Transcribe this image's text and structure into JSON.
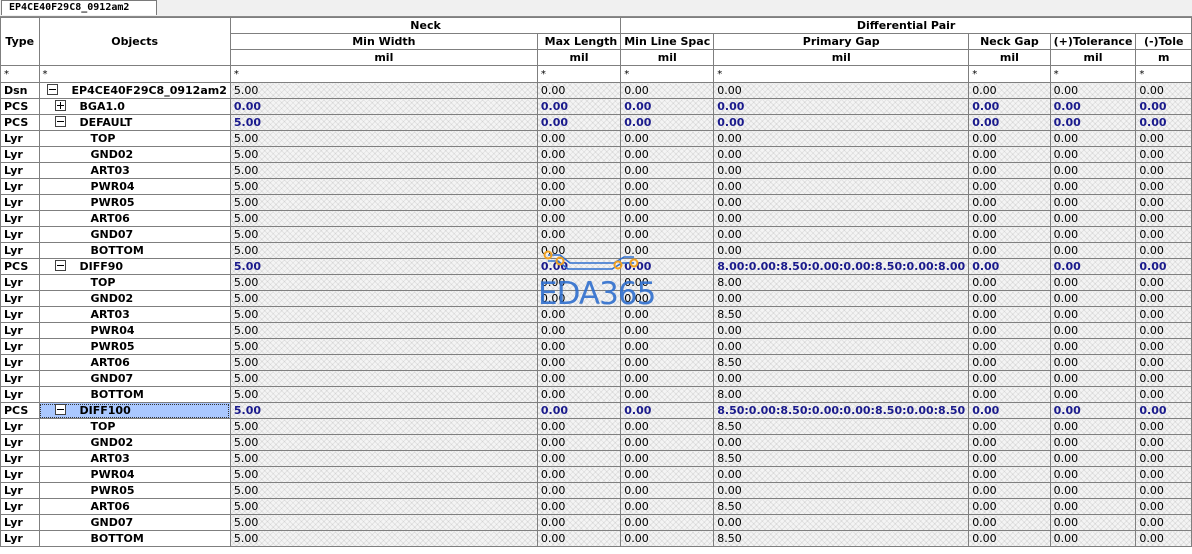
{
  "tab": {
    "title": "EP4CE40F29C8_0912am2"
  },
  "header": {
    "type": "Type",
    "objects": "Objects",
    "groups": {
      "neck": "Neck",
      "diff": "Differential Pair"
    },
    "columns": [
      "Min Width",
      "Max Length",
      "Min Line Spac",
      "Primary Gap",
      "Neck Gap",
      "(+)Tolerance",
      "(-)Tole"
    ],
    "units": [
      "mil",
      "mil",
      "mil",
      "mil",
      "mil",
      "mil",
      "m"
    ]
  },
  "filter": {
    "star": "*"
  },
  "rows": [
    {
      "type": "Dsn",
      "obj": "EP4CE40F29C8_0912am2",
      "vals": [
        "5.00",
        "0.00",
        "0.00",
        "0.00",
        "0.00",
        "0.00",
        "0.00"
      ]
    },
    {
      "type": "PCS",
      "obj": "BGA1.0",
      "vals": [
        "0.00",
        "0.00",
        "0.00",
        "0.00",
        "0.00",
        "0.00",
        "0.00"
      ]
    },
    {
      "type": "PCS",
      "obj": "DEFAULT",
      "vals": [
        "5.00",
        "0.00",
        "0.00",
        "0.00",
        "0.00",
        "0.00",
        "0.00"
      ]
    },
    {
      "type": "Lyr",
      "obj": "TOP",
      "vals": [
        "5.00",
        "0.00",
        "0.00",
        "0.00",
        "0.00",
        "0.00",
        "0.00"
      ]
    },
    {
      "type": "Lyr",
      "obj": "GND02",
      "vals": [
        "5.00",
        "0.00",
        "0.00",
        "0.00",
        "0.00",
        "0.00",
        "0.00"
      ]
    },
    {
      "type": "Lyr",
      "obj": "ART03",
      "vals": [
        "5.00",
        "0.00",
        "0.00",
        "0.00",
        "0.00",
        "0.00",
        "0.00"
      ]
    },
    {
      "type": "Lyr",
      "obj": "PWR04",
      "vals": [
        "5.00",
        "0.00",
        "0.00",
        "0.00",
        "0.00",
        "0.00",
        "0.00"
      ]
    },
    {
      "type": "Lyr",
      "obj": "PWR05",
      "vals": [
        "5.00",
        "0.00",
        "0.00",
        "0.00",
        "0.00",
        "0.00",
        "0.00"
      ]
    },
    {
      "type": "Lyr",
      "obj": "ART06",
      "vals": [
        "5.00",
        "0.00",
        "0.00",
        "0.00",
        "0.00",
        "0.00",
        "0.00"
      ]
    },
    {
      "type": "Lyr",
      "obj": "GND07",
      "vals": [
        "5.00",
        "0.00",
        "0.00",
        "0.00",
        "0.00",
        "0.00",
        "0.00"
      ]
    },
    {
      "type": "Lyr",
      "obj": "BOTTOM",
      "vals": [
        "5.00",
        "0.00",
        "0.00",
        "0.00",
        "0.00",
        "0.00",
        "0.00"
      ]
    },
    {
      "type": "PCS",
      "obj": "DIFF90",
      "vals": [
        "5.00",
        "0.00",
        "0.00",
        "8.00:0.00:8.50:0.00:0.00:8.50:0.00:8.00",
        "0.00",
        "0.00",
        "0.00"
      ]
    },
    {
      "type": "Lyr",
      "obj": "TOP",
      "vals": [
        "5.00",
        "0.00",
        "0.00",
        "8.00",
        "0.00",
        "0.00",
        "0.00"
      ]
    },
    {
      "type": "Lyr",
      "obj": "GND02",
      "vals": [
        "5.00",
        "0.00",
        "0.00",
        "0.00",
        "0.00",
        "0.00",
        "0.00"
      ]
    },
    {
      "type": "Lyr",
      "obj": "ART03",
      "vals": [
        "5.00",
        "0.00",
        "0.00",
        "8.50",
        "0.00",
        "0.00",
        "0.00"
      ]
    },
    {
      "type": "Lyr",
      "obj": "PWR04",
      "vals": [
        "5.00",
        "0.00",
        "0.00",
        "0.00",
        "0.00",
        "0.00",
        "0.00"
      ]
    },
    {
      "type": "Lyr",
      "obj": "PWR05",
      "vals": [
        "5.00",
        "0.00",
        "0.00",
        "0.00",
        "0.00",
        "0.00",
        "0.00"
      ]
    },
    {
      "type": "Lyr",
      "obj": "ART06",
      "vals": [
        "5.00",
        "0.00",
        "0.00",
        "8.50",
        "0.00",
        "0.00",
        "0.00"
      ]
    },
    {
      "type": "Lyr",
      "obj": "GND07",
      "vals": [
        "5.00",
        "0.00",
        "0.00",
        "0.00",
        "0.00",
        "0.00",
        "0.00"
      ]
    },
    {
      "type": "Lyr",
      "obj": "BOTTOM",
      "vals": [
        "5.00",
        "0.00",
        "0.00",
        "8.00",
        "0.00",
        "0.00",
        "0.00"
      ]
    },
    {
      "type": "PCS",
      "obj": "DIFF100",
      "vals": [
        "5.00",
        "0.00",
        "0.00",
        "8.50:0.00:8.50:0.00:0.00:8.50:0.00:8.50",
        "0.00",
        "0.00",
        "0.00"
      ]
    },
    {
      "type": "Lyr",
      "obj": "TOP",
      "vals": [
        "5.00",
        "0.00",
        "0.00",
        "8.50",
        "0.00",
        "0.00",
        "0.00"
      ]
    },
    {
      "type": "Lyr",
      "obj": "GND02",
      "vals": [
        "5.00",
        "0.00",
        "0.00",
        "0.00",
        "0.00",
        "0.00",
        "0.00"
      ]
    },
    {
      "type": "Lyr",
      "obj": "ART03",
      "vals": [
        "5.00",
        "0.00",
        "0.00",
        "8.50",
        "0.00",
        "0.00",
        "0.00"
      ]
    },
    {
      "type": "Lyr",
      "obj": "PWR04",
      "vals": [
        "5.00",
        "0.00",
        "0.00",
        "0.00",
        "0.00",
        "0.00",
        "0.00"
      ]
    },
    {
      "type": "Lyr",
      "obj": "PWR05",
      "vals": [
        "5.00",
        "0.00",
        "0.00",
        "0.00",
        "0.00",
        "0.00",
        "0.00"
      ]
    },
    {
      "type": "Lyr",
      "obj": "ART06",
      "vals": [
        "5.00",
        "0.00",
        "0.00",
        "8.50",
        "0.00",
        "0.00",
        "0.00"
      ]
    },
    {
      "type": "Lyr",
      "obj": "GND07",
      "vals": [
        "5.00",
        "0.00",
        "0.00",
        "0.00",
        "0.00",
        "0.00",
        "0.00"
      ]
    },
    {
      "type": "Lyr",
      "obj": "BOTTOM",
      "vals": [
        "5.00",
        "0.00",
        "0.00",
        "8.50",
        "0.00",
        "0.00",
        "0.00"
      ]
    }
  ],
  "watermark": {
    "text": "EDA365",
    "color": "#2f6fce",
    "accent": "#f0a020"
  },
  "colors": {
    "pcs_value": "#1a1a8c",
    "selection": "#aac8ff",
    "grid_line": "#7f7f7f"
  }
}
